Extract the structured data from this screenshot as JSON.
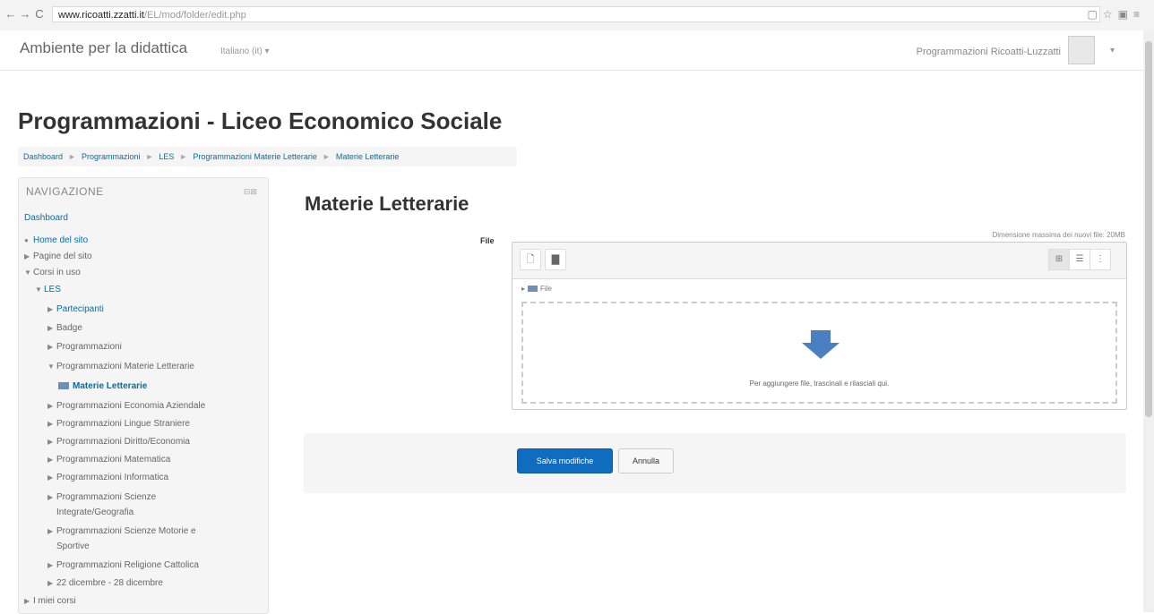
{
  "browser": {
    "url_domain": "www.ricoatti.zzatti.it",
    "url_path": "/EL/mod/folder/edit.php"
  },
  "topnav": {
    "brand": "Ambiente per la didattica",
    "language": "Italiano (it) ▾",
    "user": "Programmazioni Ricoatti-Luzzatti",
    "caret": "▾"
  },
  "page": {
    "title": "Programmazioni - Liceo Economico Sociale",
    "heading": "Materie Letterarie"
  },
  "breadcrumb": [
    "Dashboard",
    "Programmazioni",
    "LES",
    "Programmazioni Materie Letterarie",
    "Materie Letterarie"
  ],
  "breadcrumb_sep": "►",
  "navigation": {
    "title": "NAVIGAZIONE",
    "ctrl": "⊟⊠",
    "items": [
      {
        "label": "Dashboard",
        "tw": ""
      },
      {
        "label": "Home del sito",
        "tw": "●"
      },
      {
        "label": "Pagine del sito",
        "tw": "▶"
      },
      {
        "label": "Corsi in uso",
        "tw": "▼"
      },
      {
        "label": "LES",
        "tw": "▼"
      },
      {
        "label": "Partecipanti",
        "tw": "▶"
      },
      {
        "label": "Badge",
        "tw": "▶"
      },
      {
        "label": "Programmazioni",
        "tw": "▶"
      },
      {
        "label": "Programmazioni Materie Letterarie",
        "tw": "▼"
      },
      {
        "label": "Materie Letterarie",
        "tw": ""
      },
      {
        "label": "Programmazioni Economia Aziendale",
        "tw": "▶"
      },
      {
        "label": "Programmazioni Lingue Straniere",
        "tw": "▶"
      },
      {
        "label": "Programmazioni Diritto/Economia",
        "tw": "▶"
      },
      {
        "label": "Programmazioni Matematica",
        "tw": "▶"
      },
      {
        "label": "Programmazioni Informatica",
        "tw": "▶"
      },
      {
        "label": "Programmazioni Scienze",
        "tw": "▶"
      },
      {
        "label": "Integrate/Geografia",
        "tw": ""
      },
      {
        "label": "Programmazioni Scienze Motorie e",
        "tw": "▶"
      },
      {
        "label": "Sportive",
        "tw": ""
      },
      {
        "label": "Programmazioni Religione Cattolica",
        "tw": "▶"
      },
      {
        "label": "22 dicembre - 28 dicembre",
        "tw": "▶"
      },
      {
        "label": "I miei corsi",
        "tw": "▶"
      }
    ]
  },
  "form": {
    "file_label": "File",
    "max_size": "Dimensione massima dei nuovi file: 20MB",
    "path_label": "File",
    "drop_text": "Per aggiungere file, trascinali e rilasciali qui.",
    "toolbar": {
      "add_icon": "🗋",
      "folder_icon": "▇",
      "view_icons": "⊞",
      "view_list": "☰",
      "view_tree": "⋮"
    }
  },
  "buttons": {
    "save": "Salva modifiche",
    "cancel": "Annulla"
  },
  "icons": [
    "back-icon",
    "forward-icon",
    "reload-icon",
    "page-icon",
    "star-icon",
    "menu-icon",
    "arrow-down-icon",
    "folder-icon"
  ],
  "colors": {
    "link": "#0070a8",
    "primary": "#0f6cbf",
    "arrow": "#4a7fc1"
  }
}
